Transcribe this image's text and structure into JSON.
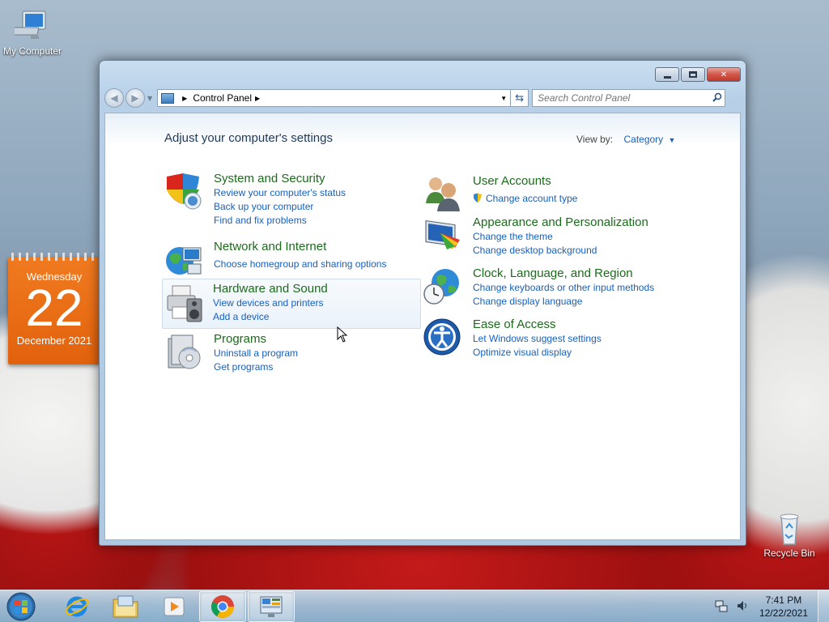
{
  "desktop": {
    "icons": [
      {
        "label": "My Computer"
      },
      {
        "label": "Recycle Bin"
      }
    ]
  },
  "calendar_gadget": {
    "weekday": "Wednesday",
    "day": "22",
    "month_year": "December 2021"
  },
  "window": {
    "breadcrumb": [
      "Control Panel"
    ],
    "search_placeholder": "Search Control Panel",
    "heading": "Adjust your computer's settings",
    "view_by_label": "View by:",
    "view_by_value": "Category",
    "categories_left": [
      {
        "title": "System and Security",
        "icon": "shield-icon",
        "links": [
          "Review your computer's status",
          "Back up your computer",
          "Find and fix problems"
        ]
      },
      {
        "title": "Network and Internet",
        "icon": "network-globe-icon",
        "links": [
          "Choose homegroup and sharing options"
        ]
      },
      {
        "title": "Hardware and Sound",
        "icon": "printer-speaker-icon",
        "links": [
          "View devices and printers",
          "Add a device"
        ]
      },
      {
        "title": "Programs",
        "icon": "programs-disc-icon",
        "links": [
          "Uninstall a program",
          "Get programs"
        ]
      }
    ],
    "categories_right": [
      {
        "title": "User Accounts",
        "icon": "users-icon",
        "links": [
          "Change account type"
        ]
      },
      {
        "title": "Appearance and Personalization",
        "icon": "monitor-palette-icon",
        "links": [
          "Change the theme",
          "Change desktop background"
        ]
      },
      {
        "title": "Clock, Language, and Region",
        "icon": "clock-globe-icon",
        "links": [
          "Change keyboards or other input methods",
          "Change display language"
        ]
      },
      {
        "title": "Ease of Access",
        "icon": "ease-of-access-icon",
        "links": [
          "Let Windows suggest settings",
          "Optimize visual display"
        ]
      }
    ]
  },
  "taskbar": {
    "apps": [
      "start-orb",
      "internet-explorer",
      "windows-explorer",
      "media-player",
      "chrome",
      "control-panel"
    ],
    "time": "7:41 PM",
    "date": "12/22/2021"
  },
  "colors": {
    "category_title": "#1a6c1a",
    "link": "#1660c0",
    "heading": "#1e395b",
    "calendar": "#e96a14"
  }
}
